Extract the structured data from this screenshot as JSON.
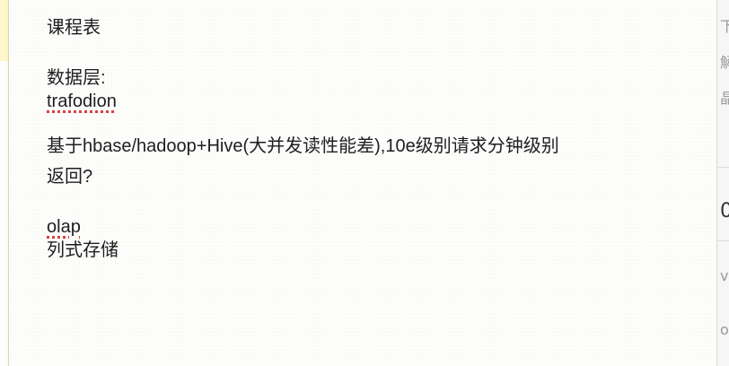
{
  "note": {
    "title": "课程表",
    "data_layer_label": "数据层:",
    "trafodion": "trafodion",
    "description_line1": "基于hbase/hadoop+Hive(大并发读性能差),10e级别请求分钟级别",
    "description_line2": "返回?",
    "olap": "olap",
    "columnar_storage": "列式存储"
  },
  "colors": {
    "page_bg": "#fdfdfc",
    "text": "#1e1e1e",
    "spellcheck_underline": "#d94040",
    "left_strip": "#fff7cc"
  }
}
